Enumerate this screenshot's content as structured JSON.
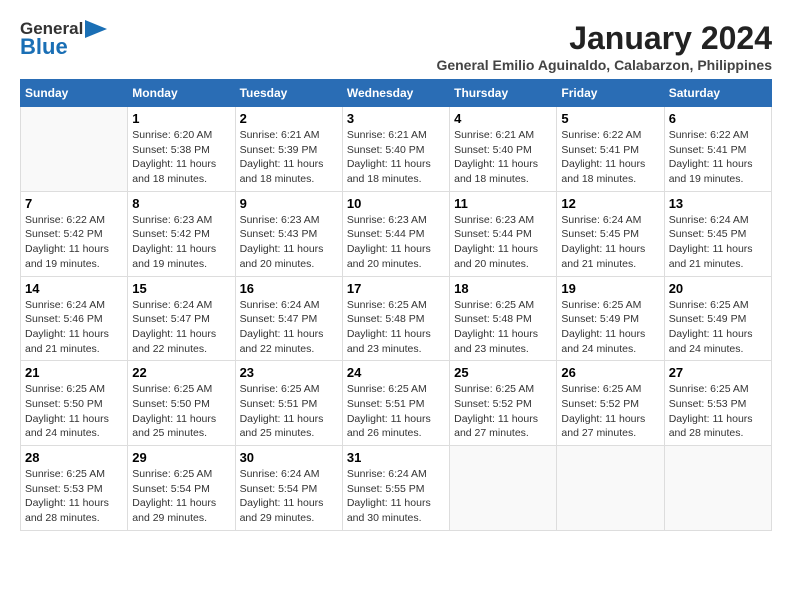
{
  "header": {
    "logo_general": "General",
    "logo_blue": "Blue",
    "month_title": "January 2024",
    "subtitle": "General Emilio Aguinaldo, Calabarzon, Philippines"
  },
  "days_of_week": [
    "Sunday",
    "Monday",
    "Tuesday",
    "Wednesday",
    "Thursday",
    "Friday",
    "Saturday"
  ],
  "weeks": [
    [
      {
        "num": "",
        "sunrise": "",
        "sunset": "",
        "daylight": ""
      },
      {
        "num": "1",
        "sunrise": "Sunrise: 6:20 AM",
        "sunset": "Sunset: 5:38 PM",
        "daylight": "Daylight: 11 hours and 18 minutes."
      },
      {
        "num": "2",
        "sunrise": "Sunrise: 6:21 AM",
        "sunset": "Sunset: 5:39 PM",
        "daylight": "Daylight: 11 hours and 18 minutes."
      },
      {
        "num": "3",
        "sunrise": "Sunrise: 6:21 AM",
        "sunset": "Sunset: 5:40 PM",
        "daylight": "Daylight: 11 hours and 18 minutes."
      },
      {
        "num": "4",
        "sunrise": "Sunrise: 6:21 AM",
        "sunset": "Sunset: 5:40 PM",
        "daylight": "Daylight: 11 hours and 18 minutes."
      },
      {
        "num": "5",
        "sunrise": "Sunrise: 6:22 AM",
        "sunset": "Sunset: 5:41 PM",
        "daylight": "Daylight: 11 hours and 18 minutes."
      },
      {
        "num": "6",
        "sunrise": "Sunrise: 6:22 AM",
        "sunset": "Sunset: 5:41 PM",
        "daylight": "Daylight: 11 hours and 19 minutes."
      }
    ],
    [
      {
        "num": "7",
        "sunrise": "Sunrise: 6:22 AM",
        "sunset": "Sunset: 5:42 PM",
        "daylight": "Daylight: 11 hours and 19 minutes."
      },
      {
        "num": "8",
        "sunrise": "Sunrise: 6:23 AM",
        "sunset": "Sunset: 5:42 PM",
        "daylight": "Daylight: 11 hours and 19 minutes."
      },
      {
        "num": "9",
        "sunrise": "Sunrise: 6:23 AM",
        "sunset": "Sunset: 5:43 PM",
        "daylight": "Daylight: 11 hours and 20 minutes."
      },
      {
        "num": "10",
        "sunrise": "Sunrise: 6:23 AM",
        "sunset": "Sunset: 5:44 PM",
        "daylight": "Daylight: 11 hours and 20 minutes."
      },
      {
        "num": "11",
        "sunrise": "Sunrise: 6:23 AM",
        "sunset": "Sunset: 5:44 PM",
        "daylight": "Daylight: 11 hours and 20 minutes."
      },
      {
        "num": "12",
        "sunrise": "Sunrise: 6:24 AM",
        "sunset": "Sunset: 5:45 PM",
        "daylight": "Daylight: 11 hours and 21 minutes."
      },
      {
        "num": "13",
        "sunrise": "Sunrise: 6:24 AM",
        "sunset": "Sunset: 5:45 PM",
        "daylight": "Daylight: 11 hours and 21 minutes."
      }
    ],
    [
      {
        "num": "14",
        "sunrise": "Sunrise: 6:24 AM",
        "sunset": "Sunset: 5:46 PM",
        "daylight": "Daylight: 11 hours and 21 minutes."
      },
      {
        "num": "15",
        "sunrise": "Sunrise: 6:24 AM",
        "sunset": "Sunset: 5:47 PM",
        "daylight": "Daylight: 11 hours and 22 minutes."
      },
      {
        "num": "16",
        "sunrise": "Sunrise: 6:24 AM",
        "sunset": "Sunset: 5:47 PM",
        "daylight": "Daylight: 11 hours and 22 minutes."
      },
      {
        "num": "17",
        "sunrise": "Sunrise: 6:25 AM",
        "sunset": "Sunset: 5:48 PM",
        "daylight": "Daylight: 11 hours and 23 minutes."
      },
      {
        "num": "18",
        "sunrise": "Sunrise: 6:25 AM",
        "sunset": "Sunset: 5:48 PM",
        "daylight": "Daylight: 11 hours and 23 minutes."
      },
      {
        "num": "19",
        "sunrise": "Sunrise: 6:25 AM",
        "sunset": "Sunset: 5:49 PM",
        "daylight": "Daylight: 11 hours and 24 minutes."
      },
      {
        "num": "20",
        "sunrise": "Sunrise: 6:25 AM",
        "sunset": "Sunset: 5:49 PM",
        "daylight": "Daylight: 11 hours and 24 minutes."
      }
    ],
    [
      {
        "num": "21",
        "sunrise": "Sunrise: 6:25 AM",
        "sunset": "Sunset: 5:50 PM",
        "daylight": "Daylight: 11 hours and 24 minutes."
      },
      {
        "num": "22",
        "sunrise": "Sunrise: 6:25 AM",
        "sunset": "Sunset: 5:50 PM",
        "daylight": "Daylight: 11 hours and 25 minutes."
      },
      {
        "num": "23",
        "sunrise": "Sunrise: 6:25 AM",
        "sunset": "Sunset: 5:51 PM",
        "daylight": "Daylight: 11 hours and 25 minutes."
      },
      {
        "num": "24",
        "sunrise": "Sunrise: 6:25 AM",
        "sunset": "Sunset: 5:51 PM",
        "daylight": "Daylight: 11 hours and 26 minutes."
      },
      {
        "num": "25",
        "sunrise": "Sunrise: 6:25 AM",
        "sunset": "Sunset: 5:52 PM",
        "daylight": "Daylight: 11 hours and 27 minutes."
      },
      {
        "num": "26",
        "sunrise": "Sunrise: 6:25 AM",
        "sunset": "Sunset: 5:52 PM",
        "daylight": "Daylight: 11 hours and 27 minutes."
      },
      {
        "num": "27",
        "sunrise": "Sunrise: 6:25 AM",
        "sunset": "Sunset: 5:53 PM",
        "daylight": "Daylight: 11 hours and 28 minutes."
      }
    ],
    [
      {
        "num": "28",
        "sunrise": "Sunrise: 6:25 AM",
        "sunset": "Sunset: 5:53 PM",
        "daylight": "Daylight: 11 hours and 28 minutes."
      },
      {
        "num": "29",
        "sunrise": "Sunrise: 6:25 AM",
        "sunset": "Sunset: 5:54 PM",
        "daylight": "Daylight: 11 hours and 29 minutes."
      },
      {
        "num": "30",
        "sunrise": "Sunrise: 6:24 AM",
        "sunset": "Sunset: 5:54 PM",
        "daylight": "Daylight: 11 hours and 29 minutes."
      },
      {
        "num": "31",
        "sunrise": "Sunrise: 6:24 AM",
        "sunset": "Sunset: 5:55 PM",
        "daylight": "Daylight: 11 hours and 30 minutes."
      },
      {
        "num": "",
        "sunrise": "",
        "sunset": "",
        "daylight": ""
      },
      {
        "num": "",
        "sunrise": "",
        "sunset": "",
        "daylight": ""
      },
      {
        "num": "",
        "sunrise": "",
        "sunset": "",
        "daylight": ""
      }
    ]
  ]
}
